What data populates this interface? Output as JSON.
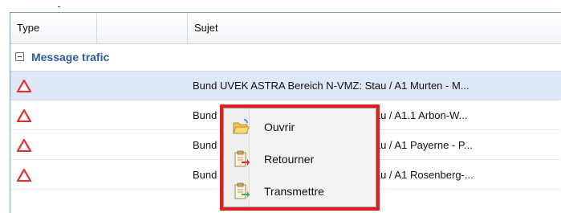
{
  "table": {
    "headers": {
      "type": "Type",
      "blank": "",
      "subject": "Sujet"
    },
    "group": {
      "label": "Message trafic"
    },
    "rows": [
      {
        "icon": "warning-triangle-icon",
        "subject": "Bund UVEK ASTRA Bereich N-VMZ: Stau / A1 Murten - M...",
        "selected": true
      },
      {
        "icon": "warning-triangle-icon",
        "subject": "Bund UVEK ASTRA Bereich N-VMZ: Stau / A1.1 Arbon-W...",
        "selected": false
      },
      {
        "icon": "warning-triangle-icon",
        "subject": "Bund UVEK ASTRA Bereich N-VMZ: Stau / A1 Payerne - P...",
        "selected": false
      },
      {
        "icon": "warning-triangle-icon",
        "subject": "Bund UVEK ASTRA Bereich N-VMZ: Stau / A1 Rosenberg-...",
        "selected": false
      }
    ]
  },
  "context_menu": {
    "items": [
      {
        "label": "Ouvrir",
        "icon": "open-folder-icon"
      },
      {
        "label": "Retourner",
        "icon": "return-document-icon"
      },
      {
        "label": "Transmettre",
        "icon": "forward-document-icon"
      }
    ],
    "highlight_color": "#e01e1e"
  },
  "colors": {
    "accent": "#2e5a9e",
    "selected_row": "#dfe8f6",
    "warning": "#e03131"
  }
}
